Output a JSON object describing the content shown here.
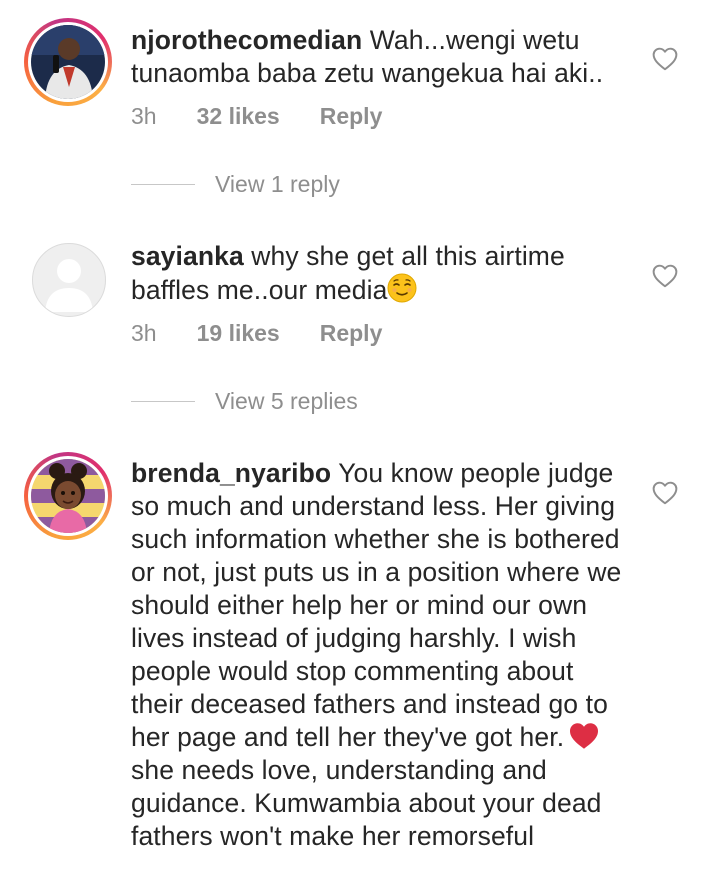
{
  "comments": [
    {
      "username": "njorothecomedian",
      "text": "Wah...wengi wetu tunaomba baba zetu wangekua hai aki..",
      "time": "3h",
      "likes": "32 likes",
      "reply": "Reply",
      "view_replies": "View 1 reply"
    },
    {
      "username": "sayianka",
      "text": "why she get all this airtime baffles me..our media",
      "time": "3h",
      "likes": "19 likes",
      "reply": "Reply",
      "view_replies": "View 5 replies"
    },
    {
      "username": "brenda_nyaribo",
      "text_part1": "You know people judge so much and understand less. Her giving such information whether she is bothered or not, just puts us in a position where we should either help her or mind our own lives instead of judging harshly. I wish people would stop commenting about their deceased fathers and instead go to her page and tell her they've got her.",
      "text_part2": "she needs love, understanding and guidance. Kumwambia about your dead fathers won't make her remorseful"
    }
  ],
  "icons": {
    "like": "heart-outline-icon",
    "relieved_emoji": "relieved-face-emoji",
    "red_heart_emoji": "red-heart-emoji",
    "default_avatar": "default-avatar-silhouette"
  },
  "colors": {
    "text": "#262626",
    "secondary": "#8e8e8e",
    "story_ring_start": "#f9a03c",
    "story_ring_end": "#c13584",
    "heart_emoji": "#dd2e44"
  }
}
